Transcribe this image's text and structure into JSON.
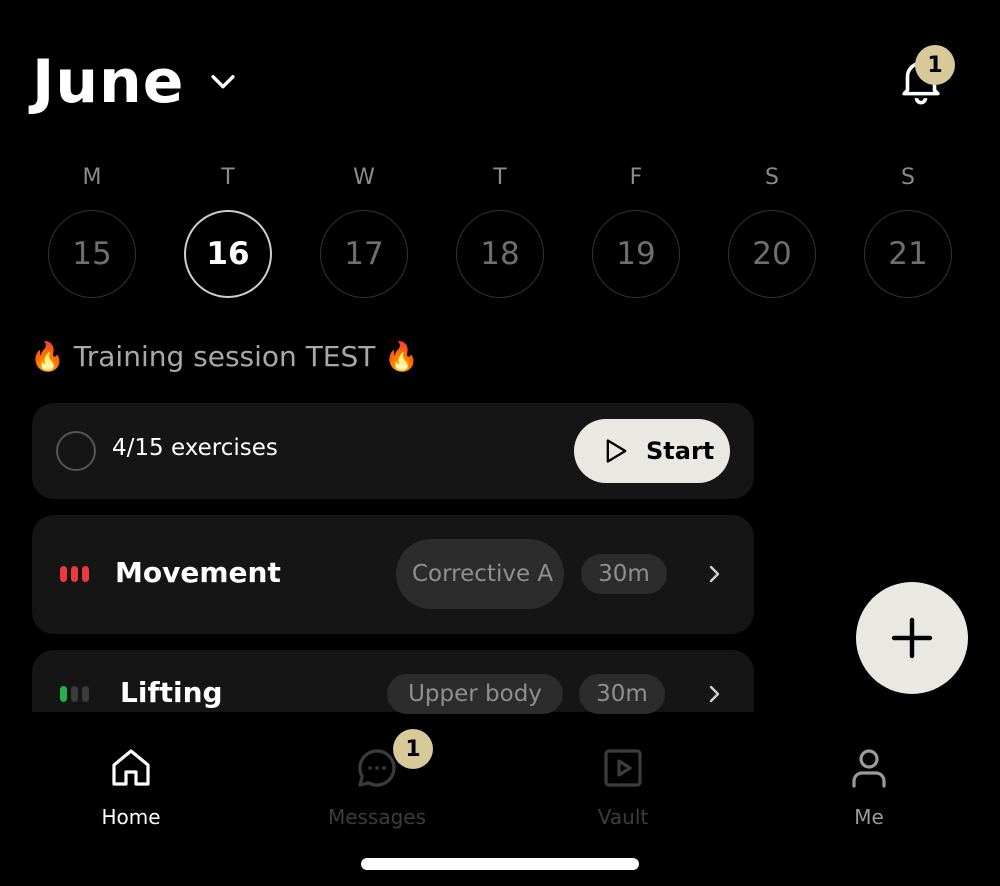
{
  "header": {
    "month": "June",
    "notifications_count": "1"
  },
  "week": [
    {
      "letter": "M",
      "day": "15",
      "active": false
    },
    {
      "letter": "T",
      "day": "16",
      "active": true
    },
    {
      "letter": "W",
      "day": "17",
      "active": false
    },
    {
      "letter": "T",
      "day": "18",
      "active": false
    },
    {
      "letter": "F",
      "day": "19",
      "active": false
    },
    {
      "letter": "S",
      "day": "20",
      "active": false
    },
    {
      "letter": "S",
      "day": "21",
      "active": false
    }
  ],
  "session": {
    "title": "🔥 Training session TEST 🔥",
    "progress_text": "4/15 exercises",
    "start_label": "Start"
  },
  "blocks": [
    {
      "title": "Movement",
      "tag": "Corrective A",
      "duration": "30m",
      "intensity": 3,
      "color": "#f0393c"
    },
    {
      "title": "Lifting",
      "tag": "Upper body",
      "duration": "30m",
      "intensity": 1,
      "color": "#22b14c"
    }
  ],
  "nav": [
    {
      "label": "Home",
      "icon": "home-icon",
      "active": true
    },
    {
      "label": "Messages",
      "icon": "chat-icon",
      "active": false,
      "badge": "1"
    },
    {
      "label": "Vault",
      "icon": "play-square-icon",
      "active": false
    },
    {
      "label": "Me",
      "icon": "person-icon",
      "active": false
    }
  ],
  "colors": {
    "background": "#000000",
    "card": "#151515",
    "accent_badge": "#d8c99a",
    "button": "#eae8e3"
  }
}
